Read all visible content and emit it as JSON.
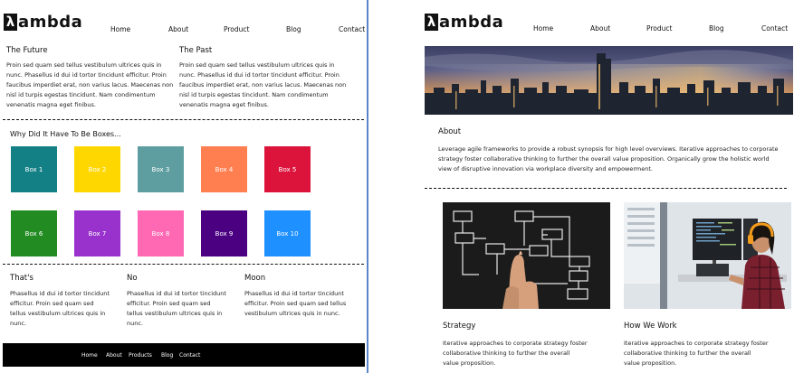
{
  "left": {
    "logo": {
      "symbol": "λ",
      "text": "ambda"
    },
    "nav": [
      "Home",
      "About",
      "Product",
      "Blog",
      "Contact"
    ],
    "future": {
      "title": "The Future",
      "body": "Proin sed quam sed tellus vestibulum ultrices quis in nunc. Phasellus id dui id tortor tincidunt efficitur. Proin faucibus imperdiet erat, non varius lacus. Maecenas non nisl id turpis egestas tincidunt. Nam condimentum venenatis magna eget finibus."
    },
    "past": {
      "title": "The Past",
      "body": "Proin sed quam sed tellus vestibulum ultrices quis in nunc. Phasellus id dui id tortor tincidunt efficitur. Proin faucibus imperdiet erat, non varius lacus. Maecenas non nisl id turpis egestas tincidunt. Nam condimentum venenatis magna eget finibus."
    },
    "boxes_title": "Why Did It Have To Be Boxes...",
    "boxes": [
      {
        "label": "Box 1",
        "color": "#138086"
      },
      {
        "label": "Box 2",
        "color": "#FFD700"
      },
      {
        "label": "Box 3",
        "color": "#5F9EA0"
      },
      {
        "label": "Box 4",
        "color": "#FF7F50"
      },
      {
        "label": "Box 5",
        "color": "#DC143C"
      },
      {
        "label": "Box 6",
        "color": "#228B22"
      },
      {
        "label": "Box 7",
        "color": "#9932CC"
      },
      {
        "label": "Box 8",
        "color": "#FF69B4"
      },
      {
        "label": "Box 9",
        "color": "#4B0082"
      },
      {
        "label": "Box 10",
        "color": "#1E90FF"
      }
    ],
    "cols": [
      {
        "title": "That's",
        "body": "Phasellus id dui id tortor tincidunt efficitur. Proin sed quam sed tellus vestibulum ultrices quis in nunc."
      },
      {
        "title": "No",
        "body": "Phasellus id dui id tortor tincidunt efficitur. Proin sed quam sed tellus vestibulum ultrices quis in nunc."
      },
      {
        "title": "Moon",
        "body": "Phasellus id dui id tortor tincidunt efficitur. Proin sed quam sed tellus vestibulum ultrices quis in nunc."
      }
    ],
    "footer": [
      "Home",
      "About",
      "Products",
      "Blog",
      "Contact"
    ]
  },
  "right": {
    "logo": {
      "symbol": "λ",
      "text": "ambda"
    },
    "nav": [
      "Home",
      "About",
      "Product",
      "Blog",
      "Contact"
    ],
    "about": {
      "title": "About",
      "body": "Leverage agile frameworks to provide a robust synopsis for high level overviews. Iterative approaches to corporate strategy foster collaborative thinking to further the overall value proposition. Organically grow the holistic world view of disruptive innovation via workplace diversity and empowerment."
    },
    "cards": [
      {
        "title": "Strategy",
        "body": "Iterative approaches to corporate strategy foster collaborative thinking to further the overall value proposition."
      },
      {
        "title": "How We Work",
        "body": "Iterative approaches to corporate strategy foster collaborative thinking to further the overall value proposition."
      }
    ]
  }
}
